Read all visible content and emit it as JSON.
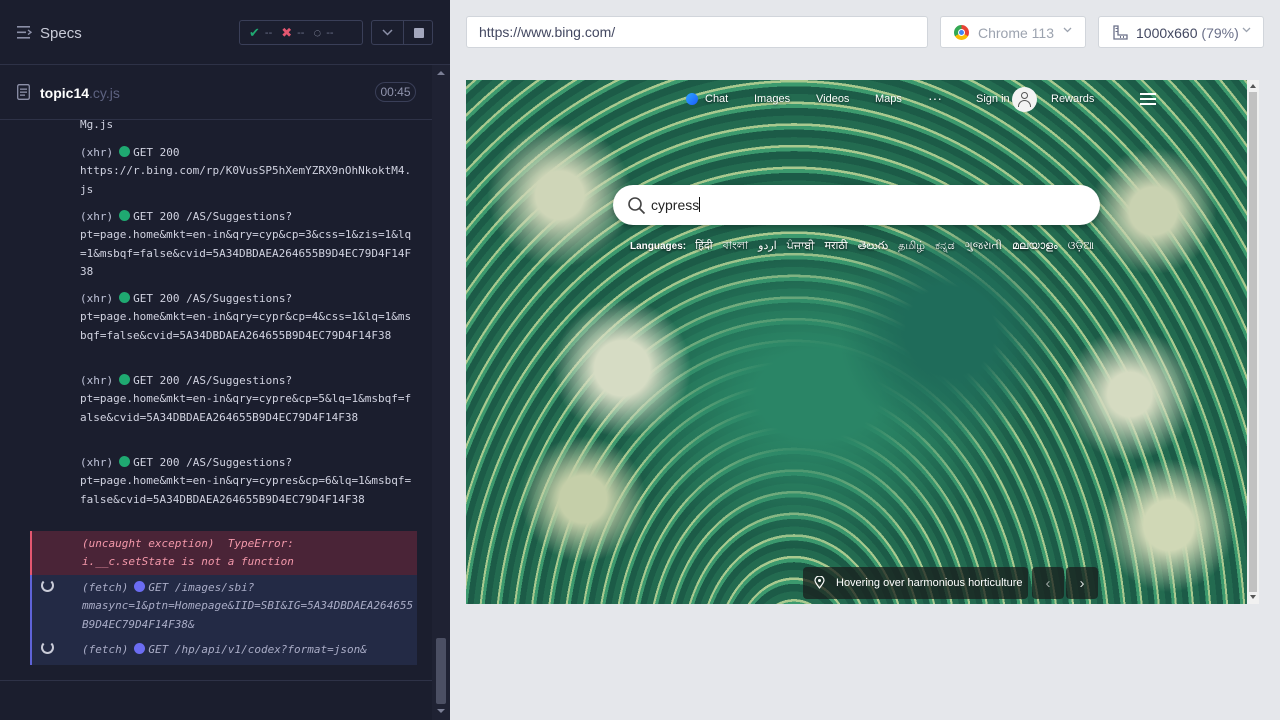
{
  "runner": {
    "title": "Specs",
    "stats": {
      "passed": "--",
      "failed": "--",
      "pending": "--"
    },
    "spec": {
      "name": "topic14",
      "ext": ".cy.js",
      "duration": "00:45"
    },
    "log": [
      {
        "kind": "",
        "text": "Mg.js",
        "state": "plain"
      },
      {
        "kind": "(xhr)",
        "method": "GET 200",
        "text": "https://r.bing.com/rp/K0VusSP5hXemYZRX9nOhNkoktM4.js",
        "state": "ok"
      },
      {
        "kind": "(xhr)",
        "method": "GET 200 /AS/Suggestions?",
        "text": "pt=page.home&mkt=en-in&qry=cyp&cp=3&css=1&zis=1&lq=1&msbqf=false&cvid=5A34DBDAEA264655B9D4EC79D4F14F38",
        "state": "ok"
      },
      {
        "kind": "(xhr)",
        "method": "GET 200 /AS/Suggestions?",
        "text": "pt=page.home&mkt=en-in&qry=cypr&cp=4&css=1&lq=1&msbqf=false&cvid=5A34DBDAEA264655B9D4EC79D4F14F38",
        "state": "ok"
      },
      {
        "kind": "(xhr)",
        "method": "GET 200 /AS/Suggestions?",
        "text": "pt=page.home&mkt=en-in&qry=cypre&cp=5&lq=1&msbqf=false&cvid=5A34DBDAEA264655B9D4EC79D4F14F38",
        "state": "ok"
      },
      {
        "kind": "(xhr)",
        "method": "GET 200 /AS/Suggestions?",
        "text": "pt=page.home&mkt=en-in&qry=cypres&cp=6&lq=1&msbqf=false&cvid=5A34DBDAEA264655B9D4EC79D4F14F38",
        "state": "ok"
      },
      {
        "kind": "(uncaught exception)",
        "method": "TypeError:",
        "text": "i.__c.setState is not a function",
        "state": "error"
      },
      {
        "kind": "(fetch)",
        "method": "GET /images/sbi?",
        "text": "mmasync=1&ptn=Homepage&IID=SBI&IG=5A34DBDAEA264655B9D4EC79D4F14F38&",
        "state": "pending"
      },
      {
        "kind": "(fetch)",
        "method": "GET /hp/api/v1/codex?format=json&",
        "text": "",
        "state": "pending"
      }
    ]
  },
  "toolbar": {
    "url": "https://www.bing.com/",
    "browser": "Chrome 113",
    "viewport": "1000x660",
    "scale": "(79%)"
  },
  "bing": {
    "nav": {
      "chat": "Chat",
      "images": "Images",
      "videos": "Videos",
      "maps": "Maps",
      "more": "···",
      "sign_in": "Sign in",
      "rewards": "Rewards"
    },
    "search_value": "cypress",
    "languages_label": "Languages:",
    "languages": [
      "हिंदी",
      "বাংলা",
      "اردو",
      "ਪੰਜਾਬੀ",
      "मराठी",
      "తెలుగు",
      "தமிழ்",
      "ಕನ್ನಡ",
      "ગુજરાતી",
      "മലയാളം",
      "ଓଡ଼ିଆ"
    ],
    "caption": "Hovering over harmonious horticulture",
    "prev": "‹",
    "next": "›"
  },
  "colors": {
    "runner_bg": "#1b1e2e",
    "pass": "#1fa971",
    "fail": "#e45770",
    "fetch": "#6b6cf2"
  }
}
